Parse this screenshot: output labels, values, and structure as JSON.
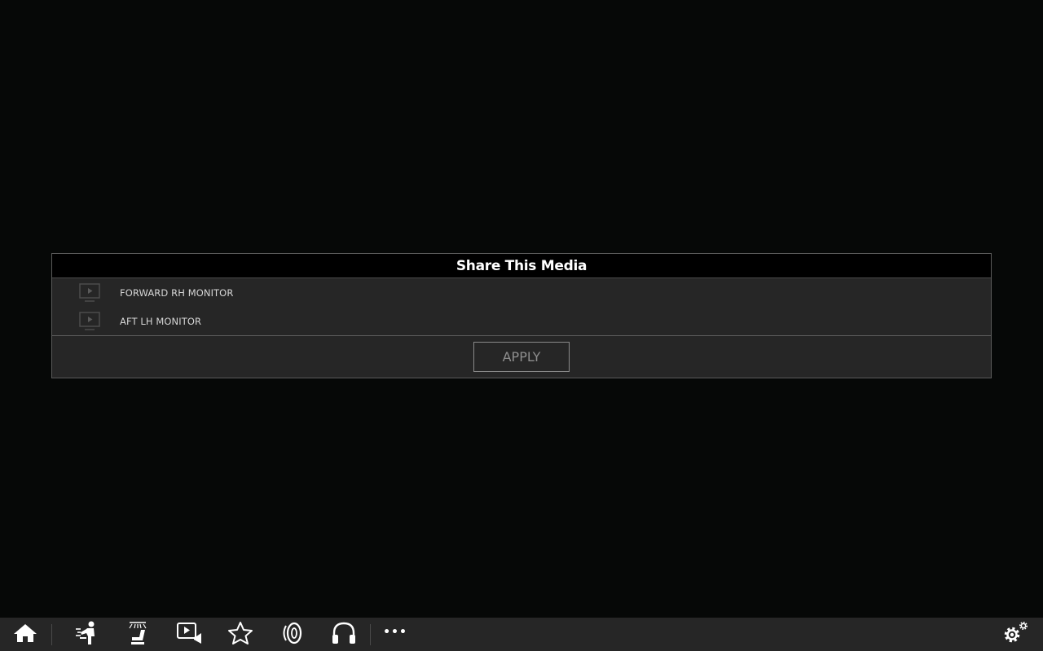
{
  "dialog": {
    "title": "Share This Media",
    "monitors": [
      {
        "label": "FORWARD RH MONITOR",
        "icon": "monitor-play-icon"
      },
      {
        "label": "AFT LH MONITOR",
        "icon": "monitor-play-icon"
      }
    ],
    "apply_label": "APPLY"
  },
  "toolbar": {
    "items": [
      {
        "name": "home",
        "icon": "home-icon"
      },
      {
        "name": "attendant",
        "icon": "attendant-call-icon"
      },
      {
        "name": "lighting",
        "icon": "seat-light-icon"
      },
      {
        "name": "media",
        "icon": "video-media-icon"
      },
      {
        "name": "favorites",
        "icon": "star-icon"
      },
      {
        "name": "speaker",
        "icon": "speaker-icon"
      },
      {
        "name": "headphones",
        "icon": "headphones-icon"
      },
      {
        "name": "more",
        "icon": "more-icon"
      },
      {
        "name": "settings",
        "icon": "settings-gears-icon"
      }
    ],
    "more_label": "•••"
  },
  "colors": {
    "background": "#060807",
    "panel": "#262626",
    "header": "#000000",
    "text": "#d6d6d6",
    "button_text": "#8e8e8e"
  }
}
